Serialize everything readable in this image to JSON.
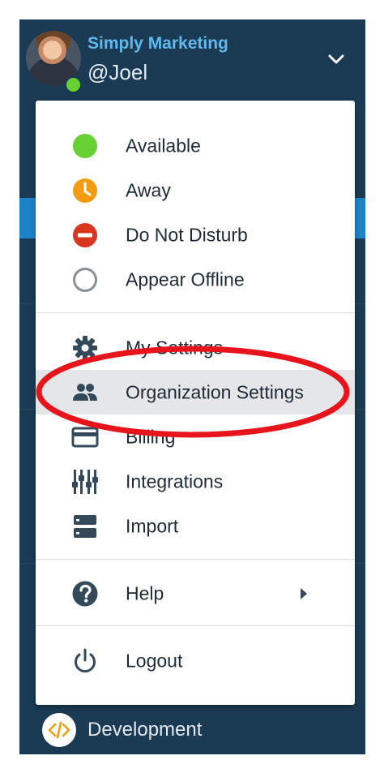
{
  "header": {
    "org_name": "Simply Marketing",
    "username": "@Joel",
    "presence_color": "#66d132"
  },
  "menu": {
    "status_items": [
      {
        "label": "Available",
        "icon": "green-dot-icon",
        "color": "#66d132"
      },
      {
        "label": "Away",
        "icon": "clock-icon",
        "color": "#f39c12"
      },
      {
        "label": "Do Not Disturb",
        "icon": "no-entry-icon",
        "color": "#d9361f"
      },
      {
        "label": "Appear Offline",
        "icon": "hollow-circle-icon",
        "color": "#8a8f94"
      }
    ],
    "settings_items": [
      {
        "label": "My Settings",
        "icon": "gear-icon"
      },
      {
        "label": "Organization Settings",
        "icon": "people-icon",
        "highlighted": true
      },
      {
        "label": "Billing",
        "icon": "credit-card-icon"
      },
      {
        "label": "Integrations",
        "icon": "sliders-icon"
      },
      {
        "label": "Import",
        "icon": "server-icon"
      }
    ],
    "help": {
      "label": "Help",
      "icon": "question-icon"
    },
    "logout": {
      "label": "Logout",
      "icon": "power-icon"
    }
  },
  "footer": {
    "label": "Development",
    "icon": "code-icon",
    "icon_color": "#f39c12"
  },
  "colors": {
    "panel_bg": "#1b3a53",
    "accent_blue": "#1d82c6",
    "annotation_red": "#e8141c"
  }
}
